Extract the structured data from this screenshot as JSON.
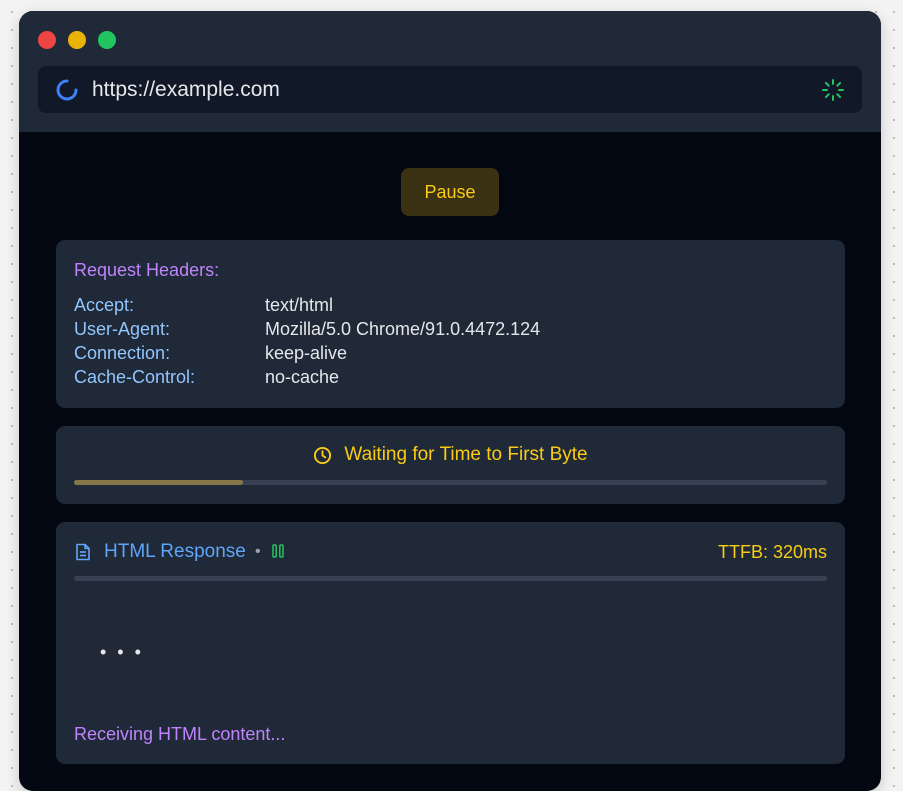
{
  "browser": {
    "url": "https://example.com"
  },
  "controls": {
    "pause_label": "Pause"
  },
  "request_headers": {
    "title": "Request Headers:",
    "rows": [
      {
        "key": "Accept:",
        "value": "text/html"
      },
      {
        "key": "User-Agent:",
        "value": "Mozilla/5.0 Chrome/91.0.4472.124"
      },
      {
        "key": "Connection:",
        "value": "keep-alive"
      },
      {
        "key": "Cache-Control:",
        "value": "no-cache"
      }
    ]
  },
  "ttfb_status": {
    "label": "Waiting for Time to First Byte",
    "progress_fraction": 0.225
  },
  "response": {
    "title": "HTML Response",
    "bullet": "•",
    "ttfb_label": "TTFB: 320ms",
    "progress_fraction": 0,
    "code_placeholder": "• • •",
    "status_text": "Receiving HTML content..."
  },
  "colors": {
    "accent_purple": "#c084fc",
    "accent_yellow": "#facc15",
    "accent_blue": "#60a5fa",
    "accent_green": "#22c55e"
  },
  "icons": [
    "spinner-icon",
    "loading-sun-icon",
    "clock-icon",
    "document-icon",
    "pause-icon"
  ]
}
